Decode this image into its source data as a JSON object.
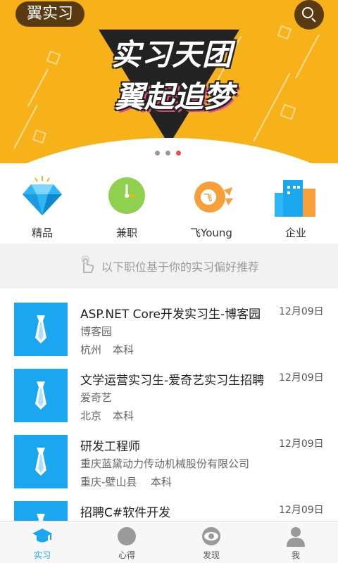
{
  "header": {
    "brand": "翼实习",
    "banner_line1": "实习天团",
    "banner_line2": "翼起追梦"
  },
  "categories": [
    {
      "label": "精品",
      "icon": "diamond-icon"
    },
    {
      "label": "兼职",
      "icon": "clock-icon"
    },
    {
      "label": "飞Young",
      "icon": "fly-young-icon"
    },
    {
      "label": "企业",
      "icon": "buildings-icon"
    }
  ],
  "recommend": {
    "text": "以下职位基于你的实习偏好推荐",
    "icon": "hand-pointer-icon"
  },
  "jobs": [
    {
      "title": "ASP.NET Core开发实习生-博客园",
      "company": "博客园",
      "location": "杭州",
      "degree": "本科",
      "date": "12月09日"
    },
    {
      "title": "文学运营实习生-爱奇艺实习生招聘",
      "company": "爱奇艺",
      "location": "北京",
      "degree": "本科",
      "date": "12月09日"
    },
    {
      "title": "研发工程师",
      "company": "重庆蓝黛动力传动机械股份有限公司",
      "location": "重庆-壁山县",
      "degree": "本科",
      "date": "12月09日"
    },
    {
      "title": "招聘C#软件开发",
      "company": "",
      "location": "",
      "degree": "",
      "date": "12月09日"
    }
  ],
  "nav": [
    {
      "label": "实习",
      "icon": "graduation-cap-icon",
      "active": true
    },
    {
      "label": "心得",
      "icon": "circle-icon",
      "active": false
    },
    {
      "label": "发现",
      "icon": "eye-icon",
      "active": false
    },
    {
      "label": "我",
      "icon": "user-icon",
      "active": false
    }
  ],
  "colors": {
    "banner": "#f7b21a",
    "accent": "#1aa7f0",
    "active_dot": "#f04b3c"
  },
  "carousel": {
    "count": 3,
    "active_index": 2
  }
}
